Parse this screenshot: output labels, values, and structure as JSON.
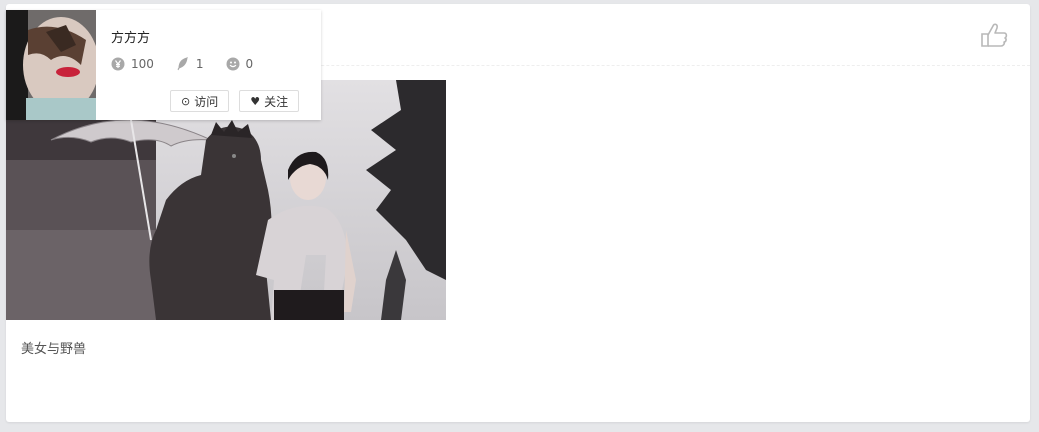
{
  "post": {
    "caption": "美女与野兽"
  },
  "profile": {
    "name": "方方方",
    "coins": "100",
    "posts": "1",
    "fans": "0",
    "visit_label": "访问",
    "follow_label": "关注"
  },
  "icons": {
    "like": "thumbs-up-icon",
    "coin": "yuan-icon",
    "feather": "feather-icon",
    "smile": "smile-icon",
    "clock": "clock-icon",
    "heart": "heart-icon"
  }
}
